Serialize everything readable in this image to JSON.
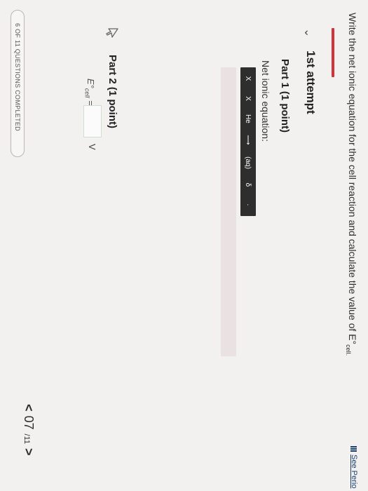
{
  "question": {
    "text": "Write the net ionic equation for the cell reaction and calculate the value of E°",
    "subscript": "cell."
  },
  "attempt": {
    "chevron": "⌄",
    "label": "1st attempt"
  },
  "part1": {
    "title": "Part 1   (1 point)",
    "net_ionic_label": "Net ionic equation:",
    "toolbar": [
      "X",
      "X",
      "He",
      "⟶",
      "(aq)",
      "δ",
      "·"
    ]
  },
  "part2": {
    "title": "Part 2   (1 point)",
    "ecell_symbol": "E°",
    "ecell_subscript": "cell",
    "ecell_equals": "=",
    "unit": "V"
  },
  "periodic_link": "See Perio",
  "pager": {
    "prev": "<",
    "current": "07",
    "total": "/11",
    "next": ">"
  },
  "progress": "6 OF 11 QUESTIONS COMPLETED",
  "colors": {
    "accent_red": "#d3323a",
    "toolbar_bg": "#2e2e2e",
    "answer_bg": "#e9e1e2",
    "link_blue": "#1a3e6e"
  }
}
